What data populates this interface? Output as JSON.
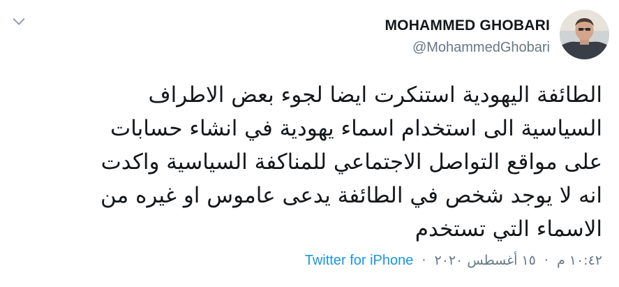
{
  "header": {
    "display_name": "MOHAMMED GHOBARI",
    "handle": "@MohammedGhobari",
    "menu_icon": "chevron-down-icon",
    "avatar_icon": "avatar"
  },
  "tweet": {
    "lines": [
      "الطائفة اليهودية استنكرت  ايضا لجوء بعض الاطراف",
      "السياسية الى استخدام اسماء يهودية في انشاء حسابات",
      "على مواقع التواصل الاجتماعي للمناكفة السياسية  واكدت",
      "انه لا يوجد شخص في الطائفة يدعى  عاموس او غيره من",
      "الاسماء التي تستخدم"
    ]
  },
  "meta": {
    "time": "١٠:٤٢ م",
    "date": "١٥ أغسطس ٢٠٢٠",
    "separator": "·",
    "source": "Twitter for iPhone"
  },
  "colors": {
    "text": "#14171a",
    "secondary": "#657786",
    "link": "#1b95e0"
  }
}
